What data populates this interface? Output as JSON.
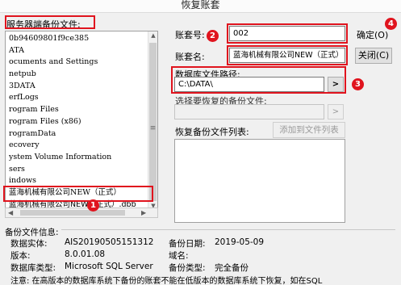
{
  "window": {
    "title": "恢复账套"
  },
  "server_files": {
    "label": "服务器端备份文件:",
    "items": [
      "0b94609801f9ce385",
      "ATA",
      "ocuments and Settings",
      "netpub",
      "3DATA",
      "erfLogs",
      "rogram Files",
      "rogram Files (x86)",
      "rogramData",
      "ecovery",
      "ystem Volume Information",
      "sers",
      "indows",
      "蓝海机械有限公司NEW（正式）",
      "蓝海机械有限公司NEW（正式）.dbb"
    ],
    "selected_index": 14
  },
  "form": {
    "account_no_label": "账套号:",
    "account_no_value": "002",
    "account_name_label": "账套名:",
    "account_name_value": "蓝海机械有限公司NEW（正式）",
    "db_path_label": "数据库文件路径:",
    "db_path_value": "C:\\DATA\\",
    "browse_label": ">",
    "backup_select_label": "选择要恢复的备份文件:",
    "backup_select_value": "",
    "backup_browse_label": ">",
    "restore_list_label": "恢复备份文件列表:",
    "add_to_list_label": "添加到文件列表"
  },
  "buttons": {
    "ok_label": "确定(O)",
    "close_label": "关闭(C)"
  },
  "info": {
    "title": "备份文件信息:",
    "entity_label": "数据实体:",
    "entity_value": "AIS20190505151312",
    "version_label": "版本:",
    "version_value": "8.0.01.08",
    "db_type_label": "数据库类型:",
    "db_type_value": "Microsoft SQL Server",
    "backup_date_label": "备份日期:",
    "backup_date_value": "2019-05-09",
    "domain_label": "域名:",
    "domain_value": "",
    "backup_type_label": "备份类型:",
    "backup_type_value": "完全备份",
    "note": "注意: 在高版本的数据库系统下备份的账套不能在低版本的数据库系统下恢复，如在SQL"
  },
  "annotations": {
    "badge_1": "1",
    "badge_2": "2",
    "badge_3": "3",
    "badge_4": "4",
    "color": "#e0141e"
  }
}
